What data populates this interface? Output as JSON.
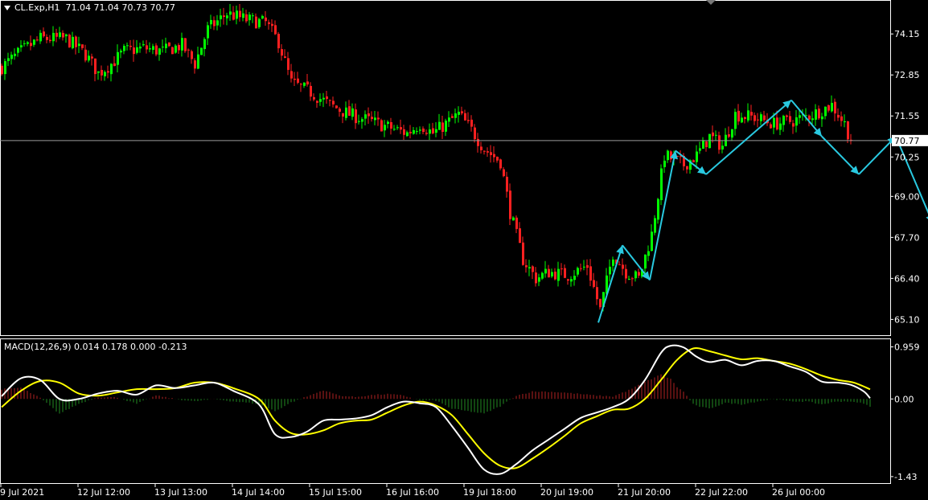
{
  "header": {
    "symbol_tf": "CL.Exp,H1",
    "ohlc": "71.04 71.04 70.73 70.77"
  },
  "macd_header": {
    "label": "MACD(12,26,9) 0.014 0.178 0.000 -0.213"
  },
  "colors": {
    "background": "#000000",
    "bull_candle": "#00ff00",
    "bear_candle": "#ff2020",
    "wave_arrow": "#29c9e0",
    "macd_line": "#ffffff",
    "signal_line": "#ffff00",
    "hist_positive": "#b22222",
    "hist_negative": "#228b22",
    "grid_axis": "#ffffff"
  },
  "chart_data": [
    {
      "type": "candlestick",
      "title": "CL.Exp,H1",
      "ylim": [
        64.6,
        75.2
      ],
      "y_ticks": [
        "74.15",
        "72.85",
        "71.55",
        "70.25",
        "69.00",
        "67.70",
        "66.40",
        "65.10"
      ],
      "current_price": "70.77",
      "x_tick_labels": [
        "9 Jul 2021",
        "12 Jul 12:00",
        "13 Jul 13:00",
        "14 Jul 14:00",
        "15 Jul 15:00",
        "16 Jul 16:00",
        "19 Jul 18:00",
        "20 Jul 19:00",
        "21 Jul 20:00",
        "22 Jul 22:00",
        "26 Jul 00:00"
      ],
      "close_path": [
        [
          0,
          73.1
        ],
        [
          6,
          73.6
        ],
        [
          12,
          74.0
        ],
        [
          20,
          74.0
        ],
        [
          26,
          73.5
        ],
        [
          30,
          72.9
        ],
        [
          34,
          73.2
        ],
        [
          38,
          73.6
        ],
        [
          44,
          73.7
        ],
        [
          50,
          73.6
        ],
        [
          56,
          73.8
        ],
        [
          60,
          73.2
        ],
        [
          64,
          74.3
        ],
        [
          70,
          74.8
        ],
        [
          76,
          74.6
        ],
        [
          82,
          74.5
        ],
        [
          86,
          73.9
        ],
        [
          90,
          72.6
        ],
        [
          96,
          72.3
        ],
        [
          102,
          71.9
        ],
        [
          108,
          71.6
        ],
        [
          114,
          71.4
        ],
        [
          120,
          71.2
        ],
        [
          126,
          71.0
        ],
        [
          130,
          71.3
        ],
        [
          134,
          71.0
        ],
        [
          138,
          71.3
        ],
        [
          142,
          71.6
        ],
        [
          146,
          71.1
        ],
        [
          150,
          70.5
        ],
        [
          155,
          70.1
        ],
        [
          158,
          68.5
        ],
        [
          162,
          67.0
        ],
        [
          166,
          66.4
        ],
        [
          170,
          66.6
        ],
        [
          176,
          66.5
        ],
        [
          182,
          66.8
        ],
        [
          186,
          65.4
        ],
        [
          190,
          67.2
        ],
        [
          194,
          66.6
        ],
        [
          198,
          66.4
        ],
        [
          202,
          67.8
        ],
        [
          206,
          70.3
        ],
        [
          212,
          70.0
        ],
        [
          216,
          70.3
        ],
        [
          220,
          70.9
        ],
        [
          224,
          70.6
        ],
        [
          228,
          71.6
        ],
        [
          234,
          71.5
        ],
        [
          240,
          71.3
        ],
        [
          246,
          71.4
        ],
        [
          252,
          71.6
        ],
        [
          258,
          71.9
        ],
        [
          262,
          71.3
        ],
        [
          264,
          70.77
        ]
      ],
      "wave_projection": [
        [
          185.5,
          65.0
        ],
        [
          193,
          67.45
        ],
        [
          201.5,
          66.35
        ],
        [
          209.5,
          70.45
        ],
        [
          219,
          69.7
        ],
        [
          245.5,
          72.05
        ],
        [
          255,
          70.9
        ],
        [
          266.5,
          69.7
        ],
        [
          278,
          70.9
        ],
        [
          289.5,
          68.15
        ]
      ]
    },
    {
      "type": "macd",
      "params": "MACD(12,26,9)",
      "ylim": [
        -1.55,
        1.1
      ],
      "y_ticks": [
        "0.959",
        "0.00",
        "-1.43"
      ],
      "macd_line": [
        [
          0,
          0.05
        ],
        [
          6,
          0.38
        ],
        [
          12,
          0.35
        ],
        [
          18,
          0.0
        ],
        [
          24,
          0.0
        ],
        [
          30,
          0.1
        ],
        [
          36,
          0.15
        ],
        [
          42,
          0.08
        ],
        [
          48,
          0.25
        ],
        [
          54,
          0.2
        ],
        [
          60,
          0.25
        ],
        [
          66,
          0.3
        ],
        [
          72,
          0.15
        ],
        [
          80,
          -0.1
        ],
        [
          85,
          -0.65
        ],
        [
          90,
          -0.7
        ],
        [
          95,
          -0.6
        ],
        [
          100,
          -0.4
        ],
        [
          105,
          -0.38
        ],
        [
          110,
          -0.36
        ],
        [
          115,
          -0.3
        ],
        [
          120,
          -0.15
        ],
        [
          125,
          -0.05
        ],
        [
          130,
          -0.08
        ],
        [
          135,
          -0.15
        ],
        [
          140,
          -0.5
        ],
        [
          145,
          -0.9
        ],
        [
          150,
          -1.3
        ],
        [
          155,
          -1.38
        ],
        [
          160,
          -1.2
        ],
        [
          165,
          -0.95
        ],
        [
          170,
          -0.75
        ],
        [
          175,
          -0.55
        ],
        [
          180,
          -0.35
        ],
        [
          185,
          -0.25
        ],
        [
          190,
          -0.15
        ],
        [
          195,
          0.0
        ],
        [
          200,
          0.35
        ],
        [
          205,
          0.85
        ],
        [
          208,
          0.98
        ],
        [
          212,
          0.95
        ],
        [
          216,
          0.78
        ],
        [
          220,
          0.68
        ],
        [
          225,
          0.72
        ],
        [
          230,
          0.62
        ],
        [
          235,
          0.7
        ],
        [
          240,
          0.7
        ],
        [
          245,
          0.6
        ],
        [
          250,
          0.5
        ],
        [
          255,
          0.32
        ],
        [
          260,
          0.3
        ],
        [
          264,
          0.26
        ],
        [
          268,
          0.14
        ],
        [
          270,
          0.014
        ]
      ],
      "signal_line": [
        [
          0,
          -0.15
        ],
        [
          6,
          0.15
        ],
        [
          12,
          0.33
        ],
        [
          18,
          0.3
        ],
        [
          24,
          0.1
        ],
        [
          30,
          0.06
        ],
        [
          36,
          0.12
        ],
        [
          42,
          0.18
        ],
        [
          48,
          0.18
        ],
        [
          54,
          0.2
        ],
        [
          60,
          0.3
        ],
        [
          66,
          0.3
        ],
        [
          72,
          0.2
        ],
        [
          80,
          0.0
        ],
        [
          85,
          -0.4
        ],
        [
          90,
          -0.63
        ],
        [
          95,
          -0.65
        ],
        [
          100,
          -0.58
        ],
        [
          105,
          -0.45
        ],
        [
          110,
          -0.4
        ],
        [
          115,
          -0.38
        ],
        [
          120,
          -0.25
        ],
        [
          125,
          -0.12
        ],
        [
          130,
          -0.05
        ],
        [
          135,
          -0.12
        ],
        [
          140,
          -0.3
        ],
        [
          145,
          -0.65
        ],
        [
          150,
          -1.0
        ],
        [
          155,
          -1.23
        ],
        [
          160,
          -1.27
        ],
        [
          165,
          -1.1
        ],
        [
          170,
          -0.9
        ],
        [
          175,
          -0.68
        ],
        [
          180,
          -0.45
        ],
        [
          185,
          -0.32
        ],
        [
          190,
          -0.2
        ],
        [
          195,
          -0.18
        ],
        [
          200,
          0.0
        ],
        [
          205,
          0.35
        ],
        [
          210,
          0.72
        ],
        [
          215,
          0.93
        ],
        [
          220,
          0.88
        ],
        [
          225,
          0.8
        ],
        [
          230,
          0.73
        ],
        [
          235,
          0.75
        ],
        [
          240,
          0.7
        ],
        [
          245,
          0.65
        ],
        [
          250,
          0.55
        ],
        [
          255,
          0.43
        ],
        [
          260,
          0.35
        ],
        [
          265,
          0.3
        ],
        [
          270,
          0.178
        ]
      ]
    }
  ]
}
